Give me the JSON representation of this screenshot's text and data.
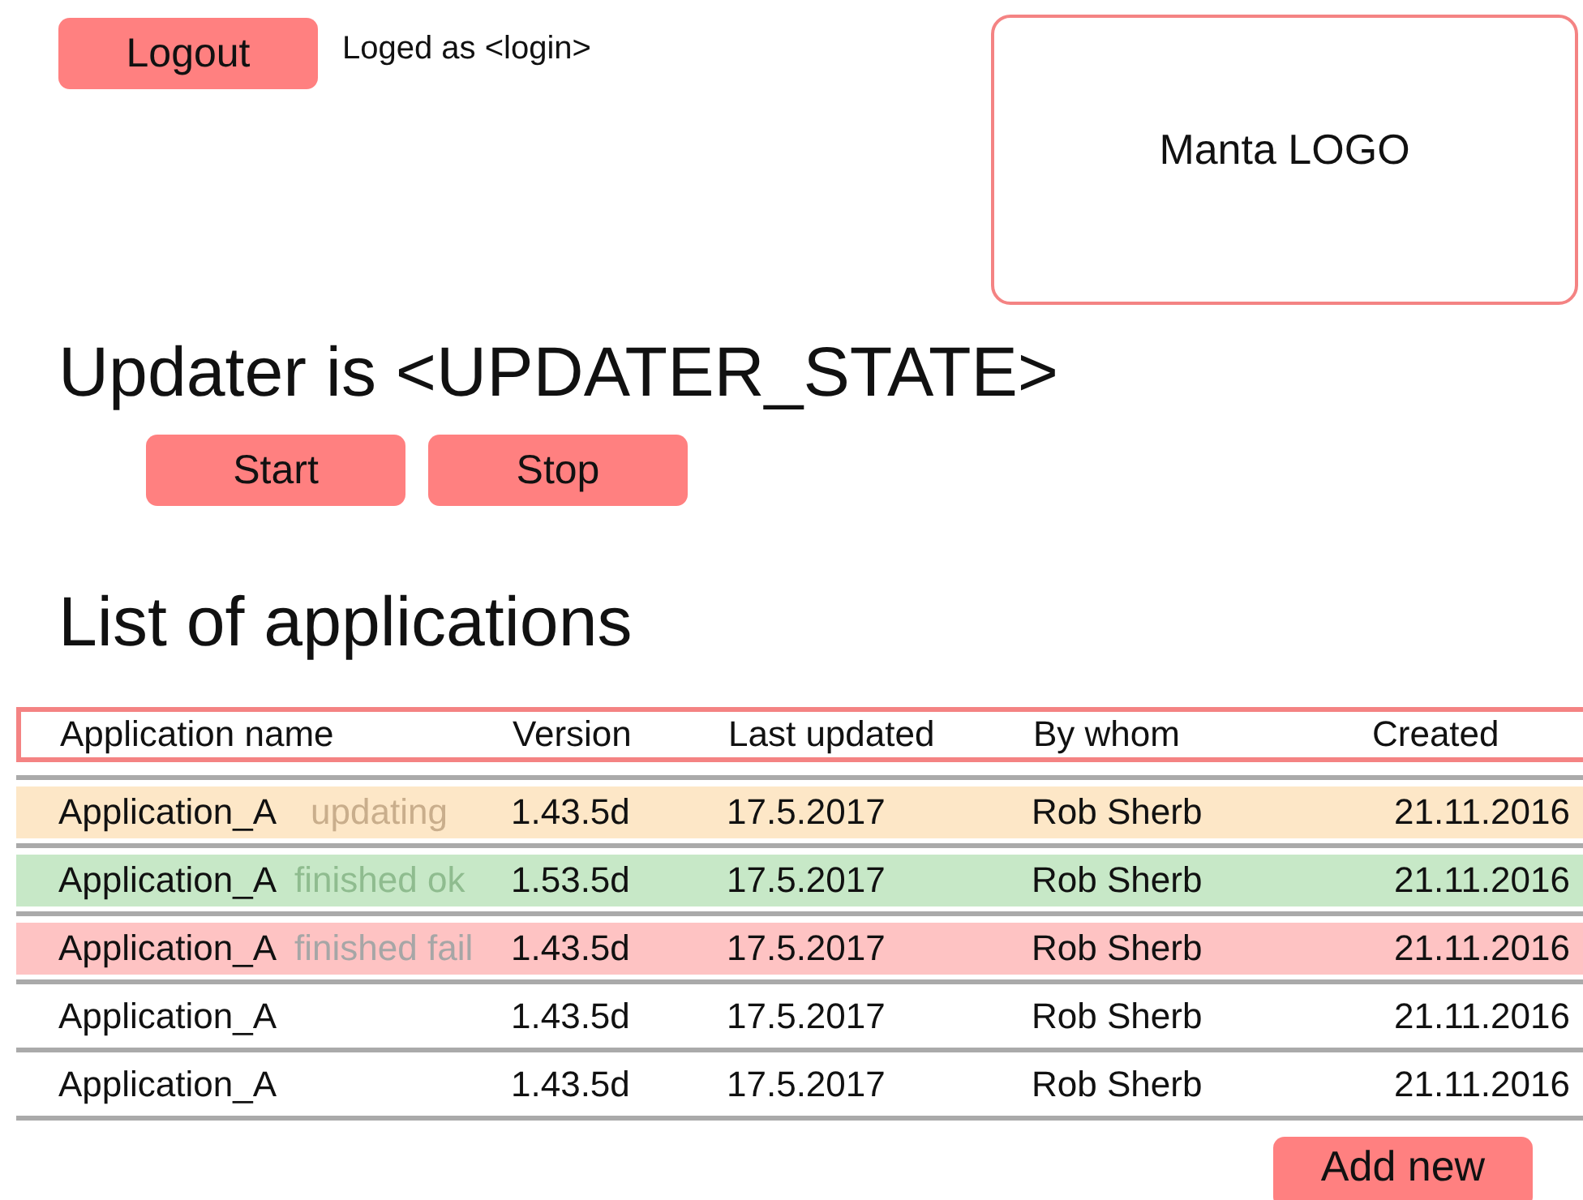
{
  "header": {
    "logout_button": "Logout",
    "login_text": "Loged as <login>",
    "logo": "Manta LOGO"
  },
  "updater": {
    "title": "Updater is <UPDATER_STATE>",
    "buttons": [
      "Start",
      "Stop"
    ]
  },
  "applications": {
    "title": "List of applications",
    "columns": [
      "Application name",
      "Version",
      "Last updated",
      "By whom",
      "Created"
    ],
    "rows": [
      {
        "name": "Application_A",
        "status": {
          "kind": "updating",
          "label": "updating"
        },
        "version": "1.43.5d",
        "last_updated": "17.5.2017",
        "by_whom": "Rob Sherb",
        "created": "21.11.2016"
      },
      {
        "name": "Application_A",
        "status": {
          "kind": "ok",
          "label": "finished ok"
        },
        "version": "1.53.5d",
        "last_updated": "17.5.2017",
        "by_whom": "Rob Sherb",
        "created": "21.11.2016"
      },
      {
        "name": "Application_A",
        "status": {
          "kind": "fail",
          "label": "finished fail"
        },
        "version": "1.43.5d",
        "last_updated": "17.5.2017",
        "by_whom": "Rob Sherb",
        "created": "21.11.2016"
      },
      {
        "name": "Application_A",
        "version": "1.43.5d",
        "last_updated": "17.5.2017",
        "by_whom": "Rob Sherb",
        "created": "21.11.2016"
      },
      {
        "name": "Application_A",
        "version": "1.43.5d",
        "last_updated": "17.5.2017",
        "by_whom": "Rob Sherb",
        "created": "21.11.2016"
      }
    ],
    "add_button": "Add new"
  }
}
